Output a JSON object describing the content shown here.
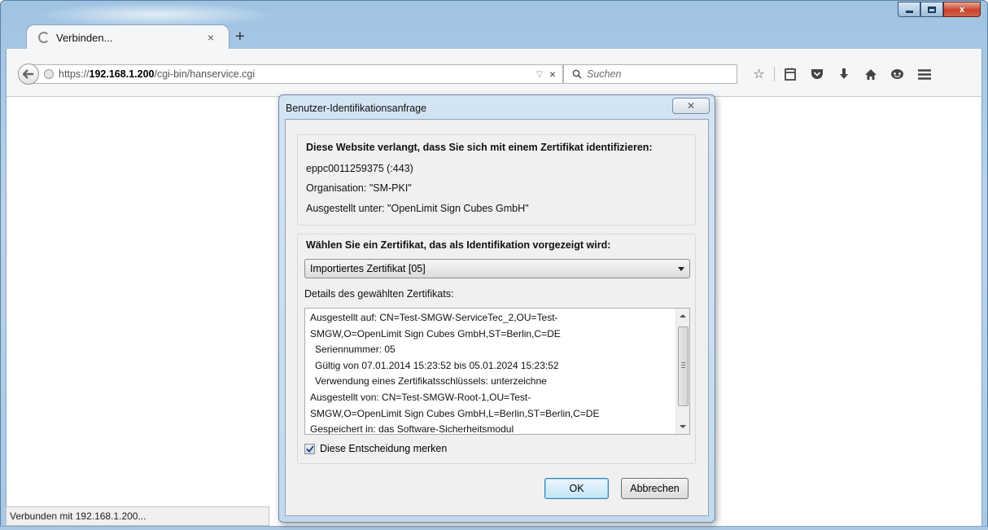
{
  "window": {
    "caption_min": "minimize",
    "caption_max": "maximize",
    "caption_close": "x"
  },
  "tab": {
    "title": "Verbinden...",
    "close": "×",
    "new_tab": "+"
  },
  "navbar": {
    "url_prefix": "https://",
    "url_host": "192.168.1.200",
    "url_path": "/cgi-bin/hanservice.cgi",
    "url_dropdown": "▽",
    "url_clear": "×",
    "search_placeholder": "Suchen",
    "icons": [
      "bookmark-star-icon",
      "reading-list-icon",
      "pocket-icon",
      "download-icon",
      "home-icon",
      "chat-icon",
      "menu-icon"
    ]
  },
  "status": {
    "text": "Verbunden mit 192.168.1.200..."
  },
  "dialog": {
    "title": "Benutzer-Identifikationsanfrage",
    "close_glyph": "✕",
    "site_section": {
      "heading": "Diese Website verlangt, dass Sie sich mit einem Zertifikat identifizieren:",
      "host": "eppc0011259375 (:443)",
      "organisation": "Organisation: \"SM-PKI\"",
      "issued_under": "Ausgestellt unter: \"OpenLimit Sign Cubes GmbH\""
    },
    "cert_section": {
      "heading": "Wählen Sie ein Zertifikat, das als Identifikation vorgezeigt wird:",
      "selected": "Importiertes Zertifikat [05]",
      "details_label": "Details des gewählten Zertifikats:",
      "details": [
        "Ausgestellt auf: CN=Test-SMGW-ServiceTec_2,OU=Test-",
        "SMGW,O=OpenLimit Sign Cubes GmbH,ST=Berlin,C=DE",
        "  Seriennummer: 05",
        "  Gültig von 07.01.2014 15:23:52 bis 05.01.2024 15:23:52",
        "  Verwendung eines Zertifikatsschlüssels: unterzeichne",
        "Ausgestellt von: CN=Test-SMGW-Root-1,OU=Test-",
        "SMGW,O=OpenLimit Sign Cubes GmbH,L=Berlin,ST=Berlin,C=DE",
        "Gespeichert in: das Software-Sicherheitsmodul"
      ],
      "remember_label": "Diese Entscheidung merken",
      "remember_checked": true
    },
    "ok_label": "OK",
    "cancel_label": "Abbrechen"
  }
}
